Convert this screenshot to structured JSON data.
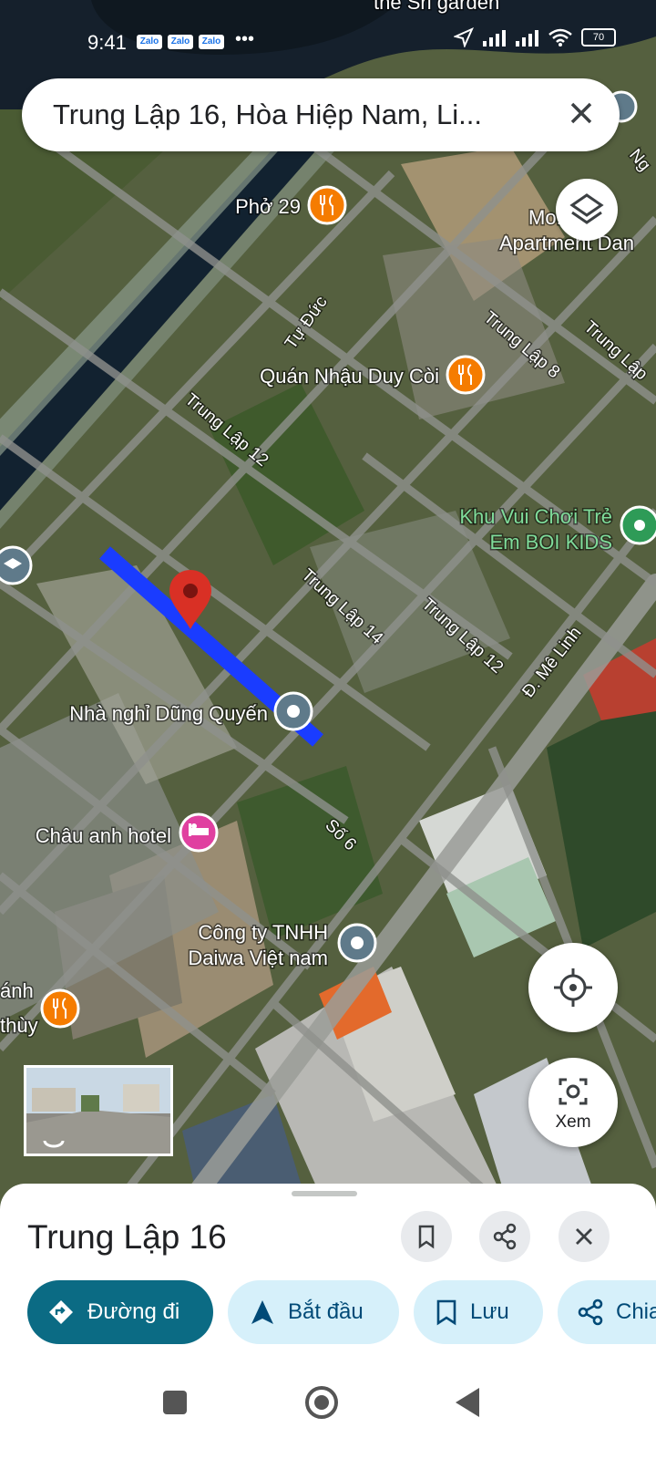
{
  "status_bar": {
    "time": "9:41",
    "apps": [
      "Zalo",
      "Zalo",
      "Zalo"
    ],
    "more": "•••",
    "battery": "70"
  },
  "search": {
    "query": "Trung Lập 16, Hòa Hiệp Nam, Li..."
  },
  "map": {
    "partial_top_label": "the Sri garden",
    "pois": [
      {
        "name": "Phở 29",
        "icon": "restaurant-icon",
        "color": "#f57c00"
      },
      {
        "name": "Quán Nhậu Duy Còi",
        "icon": "restaurant-icon",
        "color": "#f57c00"
      },
      {
        "name": "Khu Vui Chơi Trẻ Em BOI KIDS",
        "line1": "Khu Vui Chơi Trẻ",
        "line2": "Em BOI KIDS",
        "icon": "park-icon",
        "color": "#2e9b57"
      },
      {
        "name": "Nhà nghỉ Dũng Quyến",
        "icon": "place-pin-icon",
        "color": "#5f7a8a"
      },
      {
        "name": "Châu anh hotel",
        "icon": "hotel-icon",
        "color": "#e040a0"
      },
      {
        "name": "Công ty TNHH Daiwa Việt nam",
        "line1": "Công ty TNHH",
        "line2": "Daiwa Việt nam",
        "icon": "place-pin-icon",
        "color": "#5f7a8a"
      },
      {
        "name": "Apartment",
        "line1": "Mo... Mo",
        "line2": "Apartment Dan",
        "icon": "none",
        "color": "#ffffff"
      },
      {
        "name": "ánh thùy",
        "line1": "ánh",
        "line2": "thùy",
        "icon": "restaurant-icon",
        "color": "#f57c00"
      }
    ],
    "roads": [
      "Tự Đức",
      "Trung Lập 12",
      "Trung Lập 8",
      "Trung Lập 14",
      "Trung Lập 12",
      "Đ. Mê Linh",
      "Số 6",
      "Trung Lập",
      "Ng"
    ],
    "selected_road": "Trung Lập 16",
    "route_color": "#1a3cff",
    "pin_color": "#d93025"
  },
  "controls": {
    "layers": "layers-icon",
    "locate": "my-location-icon",
    "view_label": "Xem"
  },
  "sheet": {
    "title": "Trung Lập 16",
    "actions": [
      {
        "label": "Đường đi",
        "icon": "directions-icon"
      },
      {
        "label": "Bắt đầu",
        "icon": "navigation-icon"
      },
      {
        "label": "Lưu",
        "icon": "bookmark-icon"
      },
      {
        "label": "Chia sẻ",
        "icon": "share-icon"
      }
    ],
    "chip_accent": "#0b6b84",
    "chip_bg": "#d6f0fa"
  }
}
